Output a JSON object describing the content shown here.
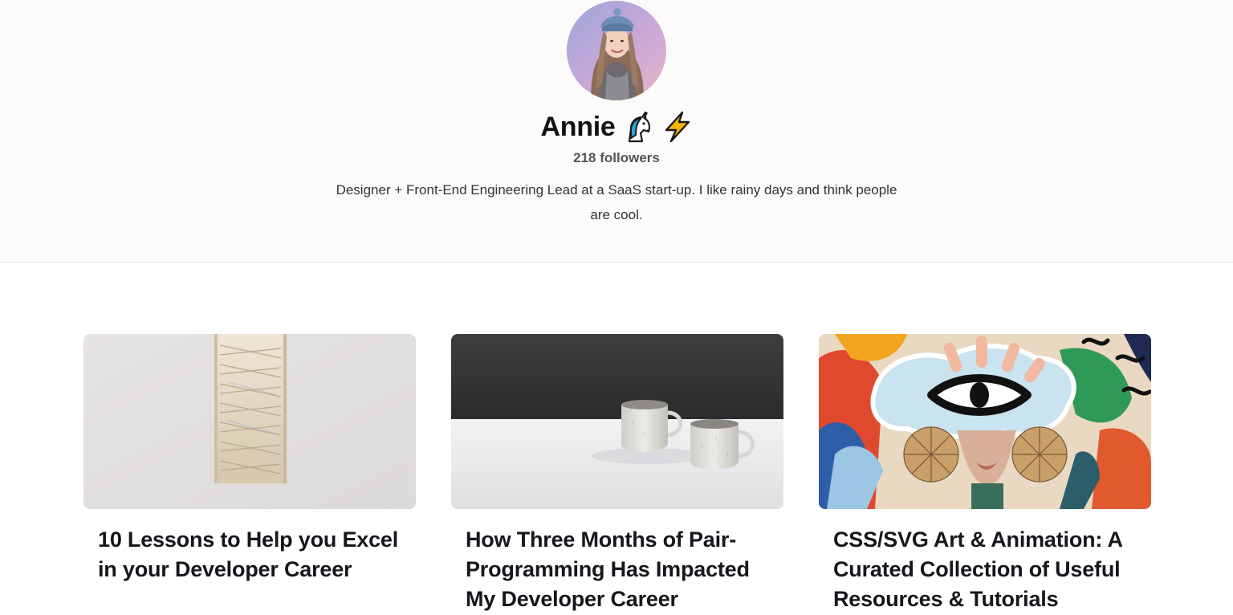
{
  "profile": {
    "name": "Annie",
    "badges": [
      "unicorn-icon",
      "lightning-icon"
    ],
    "followers": "218 followers",
    "bio": "Designer + Front-End Engineering Lead at a SaaS start-up. I like rainy days and think people are cool."
  },
  "posts": [
    {
      "title": "10 Lessons to Help you Excel in your Developer Career",
      "image": "staircase-photo"
    },
    {
      "title": "How Three Months of Pair-Programming Has Impacted My Developer Career",
      "image": "coffee-mugs-photo"
    },
    {
      "title": "CSS/SVG Art & Animation: A Curated Collection of Useful Resources & Tutorials",
      "image": "colorful-mural-photo"
    }
  ],
  "colors": {
    "header_bg": "#fcfbfa",
    "title_text": "#15171c",
    "lightning": "#f5b400",
    "unicorn_mane": "#28a8e0"
  }
}
